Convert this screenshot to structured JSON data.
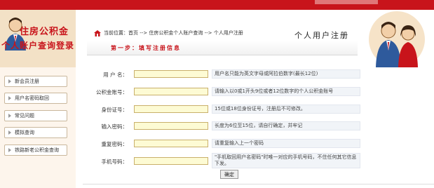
{
  "logo": {
    "line1": "住房公积金",
    "line2": "个人账户查询登录"
  },
  "sidebar": {
    "items": [
      {
        "label": "新会员注册"
      },
      {
        "label": "用户名密码取回"
      },
      {
        "label": "常见问题"
      },
      {
        "label": "模拟查询"
      },
      {
        "label": "铁路新老公积金查询"
      }
    ]
  },
  "breadcrumb": {
    "text": "当前位置：首页 --> 住房公积金个人账户查询 --> 个人用户注册"
  },
  "page_title": "个人用户注册",
  "step": {
    "text": "第一步：填写注册信息"
  },
  "form": {
    "fields": [
      {
        "label": "用 户 名：",
        "value": "",
        "hint": "用户名只能为英文字母或阿拉伯数字(最长12位)"
      },
      {
        "label": "公积金账号：",
        "value": "",
        "hint": "请输入以0或1开头9位或者12位数字的个人公积金账号"
      },
      {
        "label": "身份证号：",
        "value": "",
        "hint": "15位或18位身份证号，注册后不可修改。"
      },
      {
        "label": "输入密码：",
        "value": "",
        "hint": "长度为6位至15位，请自行确定，并牢记"
      },
      {
        "label": "重复密码：",
        "value": "",
        "hint": "请重复输入上一个密码"
      },
      {
        "label": "手机号码：",
        "value": "",
        "hint": "\"手机取回用户名密码\"时唯一对应的手机号码，不住任何其它信息下发。"
      }
    ],
    "submit_label": "确定"
  },
  "colors": {
    "brand_red": "#c8141b",
    "input_bg": "#fdfbd4",
    "hint_bg": "#f1f4f8",
    "panel_bg": "#fdf5ec"
  }
}
